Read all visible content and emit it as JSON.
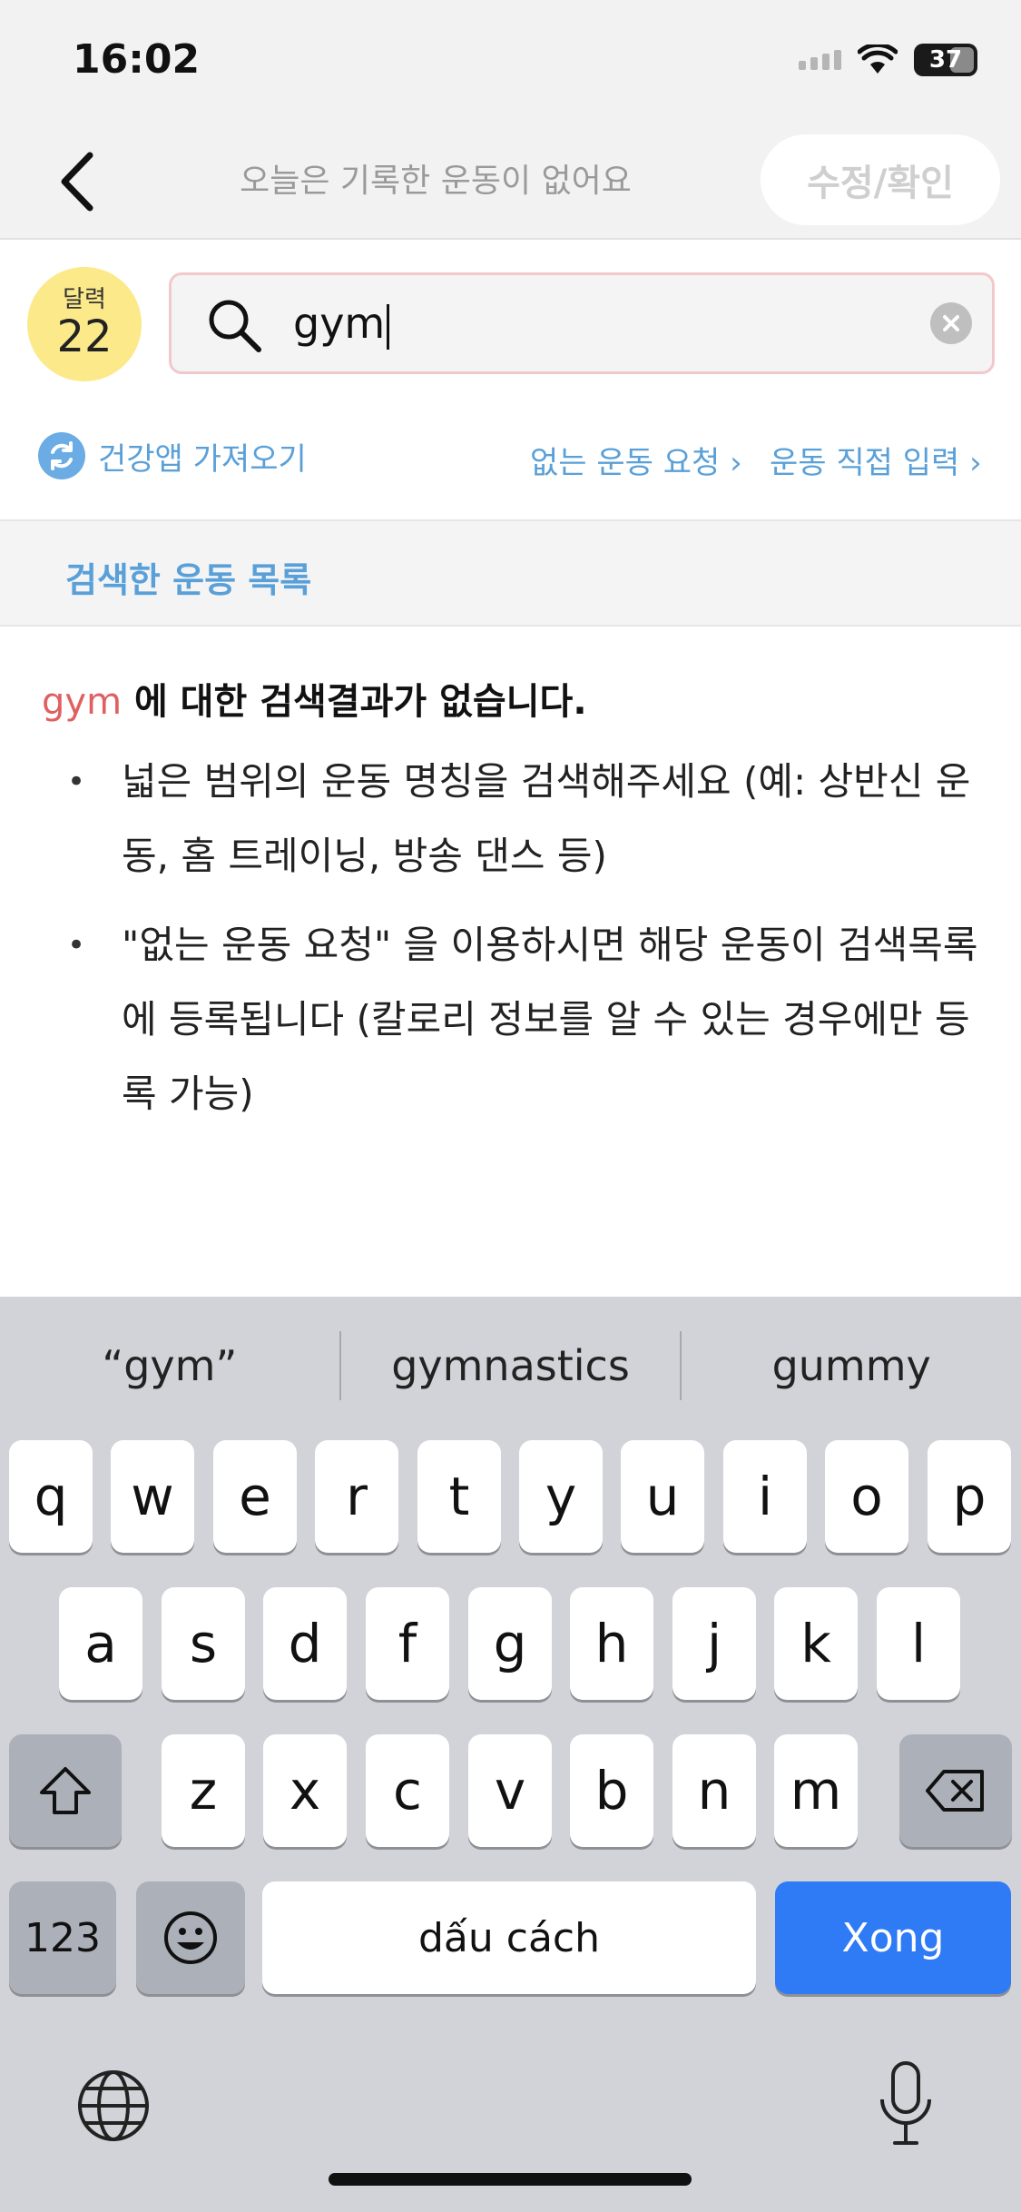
{
  "status": {
    "time": "16:02",
    "battery": "37"
  },
  "header": {
    "title": "오늘은 기록한 운동이 없어요",
    "edit_label": "수정/확인"
  },
  "date_badge": {
    "label": "달력",
    "day": "22"
  },
  "search": {
    "value": "gym"
  },
  "links": {
    "health_import": "건강앱 가져오기",
    "request_missing": "없는 운동 요청 ›",
    "direct_input": "운동 직접 입력 ›"
  },
  "section": {
    "title": "검색한 운동 목록"
  },
  "results": {
    "keyword": "gym",
    "no_result_text": " 에 대한 검색결과가 없습니다.",
    "tips": [
      "넓은 범위의 운동 명칭을 검색해주세요 (예: 상반신 운동, 홈 트레이닝, 방송 댄스 등)",
      "\"없는 운동 요청\" 을 이용하시면 해당 운동이 검색목록에 등록됩니다 (칼로리 정보를 알 수 있는 경우에만 등록 가능)"
    ]
  },
  "keyboard": {
    "suggestions": [
      "“gym”",
      "gymnastics",
      "gummy"
    ],
    "row1": [
      "q",
      "w",
      "e",
      "r",
      "t",
      "y",
      "u",
      "i",
      "o",
      "p"
    ],
    "row2": [
      "a",
      "s",
      "d",
      "f",
      "g",
      "h",
      "j",
      "k",
      "l"
    ],
    "row3": [
      "z",
      "x",
      "c",
      "v",
      "b",
      "n",
      "m"
    ],
    "numbers_label": "123",
    "space_label": "dấu cách",
    "done_label": "Xong"
  }
}
